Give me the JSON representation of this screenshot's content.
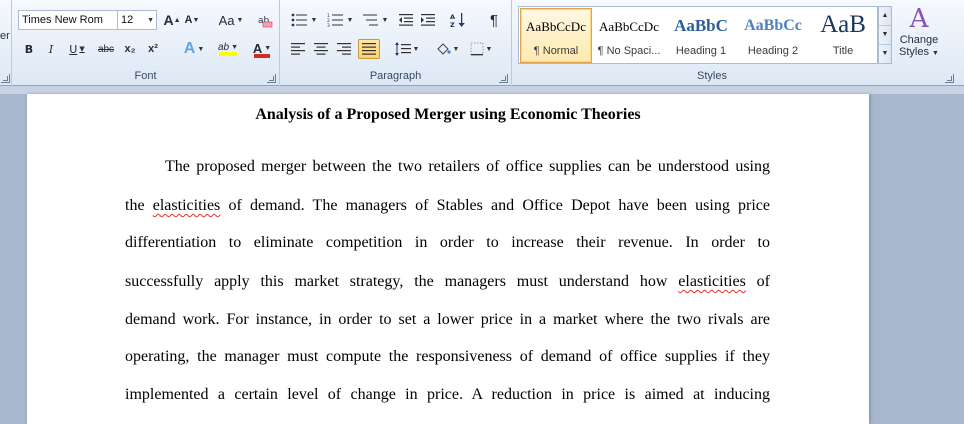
{
  "font_group": {
    "label": "Font",
    "font_name": "Times New Rom",
    "font_size": "12",
    "grow_font": "A",
    "shrink_font": "A",
    "change_case": "Aa",
    "bold": "B",
    "italic": "I",
    "underline": "U",
    "strikethrough": "abc",
    "subscript": "x₂",
    "superscript": "x²",
    "text_effects": "A",
    "highlight": "ab",
    "font_color": "A",
    "highlight_color": "#ffff00",
    "font_color_value": "#d42a1f"
  },
  "paragraph_group": {
    "label": "Paragraph",
    "show_marks": "¶"
  },
  "styles_group": {
    "label": "Styles",
    "styles": [
      {
        "sample": "AaBbCcDc",
        "name": "¶ Normal",
        "active": true
      },
      {
        "sample": "AaBbCcDc",
        "name": "¶ No Spaci...",
        "active": false
      },
      {
        "sample": "AaBbC",
        "name": "Heading 1",
        "active": false
      },
      {
        "sample": "AaBbCc",
        "name": "Heading 2",
        "active": false
      },
      {
        "sample": "AaB",
        "name": "Title",
        "active": false
      }
    ],
    "change_styles_label_1": "Change",
    "change_styles_label_2": "Styles",
    "change_styles_icon": "A"
  },
  "left_clip_text": "er",
  "document": {
    "title": "Analysis of a Proposed Merger using Economic Theories",
    "lines": [
      "The proposed merger between the two retailers of office supplies can be understood using",
      [
        "the ",
        {
          "sq": "elasticities"
        },
        " of demand. The managers of Stables and Office Depot have been using price"
      ],
      "differentiation to eliminate competition in order to increase their revenue. In order to",
      [
        "successfully apply this market strategy, the managers must understand how ",
        {
          "sq": "elasticities"
        },
        " of"
      ],
      "demand work. For instance, in order to set a lower price in a market where the two rivals are",
      "operating, the manager must compute the responsiveness of demand of office supplies if they",
      "implemented a certain level of change in price. A reduction in price is aimed at inducing"
    ]
  }
}
